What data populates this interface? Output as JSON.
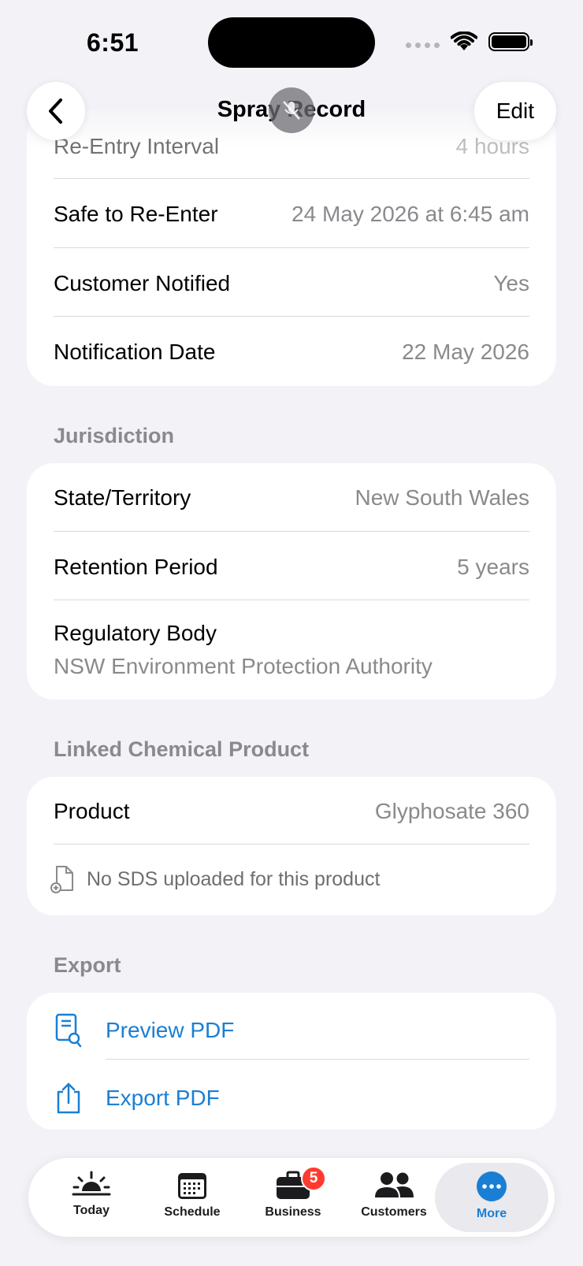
{
  "status_bar": {
    "time": "6:51"
  },
  "nav": {
    "title": "Spray Record",
    "edit_label": "Edit"
  },
  "compliance": {
    "rows": [
      {
        "label": "Re-Entry Interval",
        "value": "4 hours"
      },
      {
        "label": "Safe to Re-Enter",
        "value": "24 May 2026 at 6:45 am"
      },
      {
        "label": "Customer Notified",
        "value": "Yes"
      },
      {
        "label": "Notification Date",
        "value": "22 May 2026"
      }
    ]
  },
  "jurisdiction": {
    "header": "Jurisdiction",
    "rows": [
      {
        "label": "State/Territory",
        "value": "New South Wales"
      },
      {
        "label": "Retention Period",
        "value": "5 years"
      }
    ],
    "regulatory": {
      "label": "Regulatory Body",
      "value": "NSW Environment Protection Authority"
    }
  },
  "linked_product": {
    "header": "Linked Chemical Product",
    "product_label": "Product",
    "product_value": "Glyphosate 360",
    "sds_note": "No SDS uploaded for this product"
  },
  "export": {
    "header": "Export",
    "preview_label": "Preview PDF",
    "export_label": "Export PDF"
  },
  "tabbar": {
    "tabs": [
      {
        "label": "Today",
        "icon": "sunrise-icon"
      },
      {
        "label": "Schedule",
        "icon": "calendar-icon"
      },
      {
        "label": "Business",
        "icon": "briefcase-icon",
        "badge": "5"
      },
      {
        "label": "Customers",
        "icon": "people-icon"
      },
      {
        "label": "More",
        "icon": "ellipsis-circle-icon",
        "active": true
      }
    ]
  },
  "colors": {
    "accent": "#1a7fd4",
    "badge": "#ff3b30",
    "background": "#f2f2f7"
  }
}
